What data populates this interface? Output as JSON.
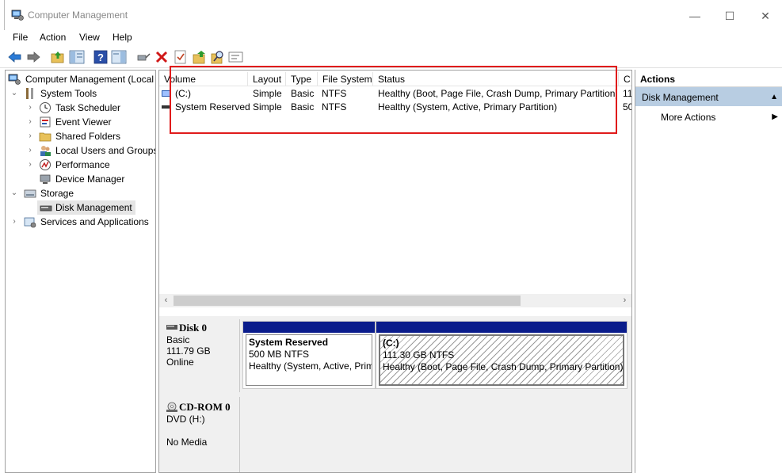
{
  "window": {
    "title": "Computer Management",
    "controls": {
      "minimize": "—",
      "maximize": "☐",
      "close": "✕"
    }
  },
  "menu": [
    "File",
    "Action",
    "View",
    "Help"
  ],
  "toolbar": {
    "icons": [
      "back-arrow-icon",
      "forward-arrow-icon",
      "up-folder-icon",
      "show-hide-tree-icon",
      "help-icon",
      "action-pane-icon",
      "connect-icon",
      "delete-icon",
      "check-icon",
      "export-icon",
      "find-icon",
      "properties-icon"
    ]
  },
  "tree": {
    "root": "Computer Management (Local",
    "items": [
      {
        "label": "System Tools",
        "twisty": "⌄"
      },
      {
        "label": "Task Scheduler",
        "twisty": "›"
      },
      {
        "label": "Event Viewer",
        "twisty": "›"
      },
      {
        "label": "Shared Folders",
        "twisty": "›"
      },
      {
        "label": "Local Users and Groups",
        "twisty": "›"
      },
      {
        "label": "Performance",
        "twisty": "›"
      },
      {
        "label": "Device Manager",
        "twisty": ""
      },
      {
        "label": "Storage",
        "twisty": "⌄"
      },
      {
        "label": "Disk Management",
        "twisty": ""
      },
      {
        "label": "Services and Applications",
        "twisty": "›"
      }
    ]
  },
  "volumes": {
    "columns": [
      "Volume",
      "Layout",
      "Type",
      "File System",
      "Status",
      "C"
    ],
    "rows": [
      {
        "volume": "(C:)",
        "layout": "Simple",
        "type": "Basic",
        "fs": "NTFS",
        "status": "Healthy (Boot, Page File, Crash Dump, Primary Partition)",
        "cap": "11"
      },
      {
        "volume": "System Reserved",
        "layout": "Simple",
        "type": "Basic",
        "fs": "NTFS",
        "status": "Healthy (System, Active, Primary Partition)",
        "cap": "50"
      }
    ]
  },
  "scrollbar": {
    "left": "‹",
    "right": "›"
  },
  "disks": [
    {
      "name": "Disk 0",
      "type": "Basic",
      "size": "111.79 GB",
      "state": "Online",
      "partitions": [
        {
          "name": "System Reserved",
          "size": "500 MB NTFS",
          "status": "Healthy (System, Active, Prim"
        },
        {
          "name": "(C:)",
          "size": "111.30 GB NTFS",
          "status": "Healthy (Boot, Page File, Crash Dump, Primary Partition)"
        }
      ]
    },
    {
      "name": "CD-ROM 0",
      "type": "DVD (H:)",
      "state": "No Media"
    }
  ],
  "actions": {
    "title": "Actions",
    "section": "Disk Management",
    "section_arrow": "▲",
    "more": "More Actions",
    "more_arrow": "▶"
  }
}
